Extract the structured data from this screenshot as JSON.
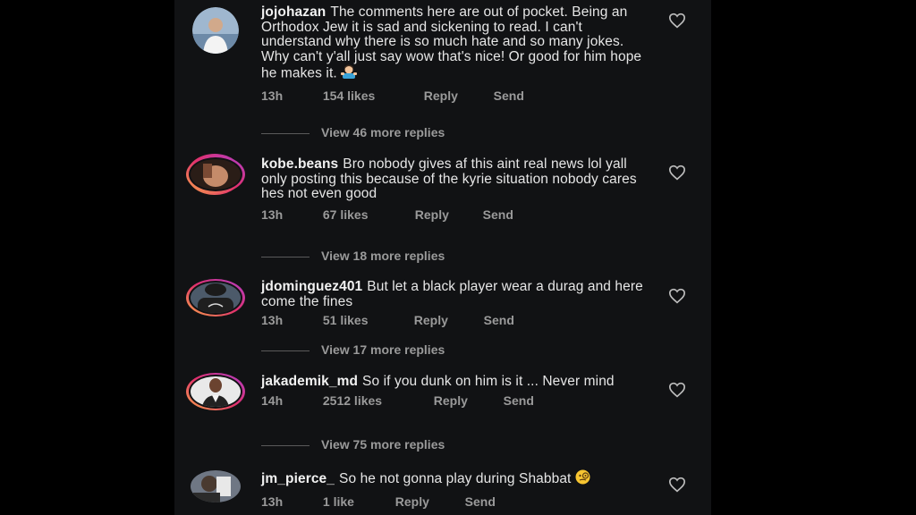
{
  "comments": [
    {
      "username": "jojohazan",
      "text": "The comments here are out of pocket. Being an Orthodox Jew it is sad and sickening to read. I can't understand why there is so much hate and so many jokes. Why can't y'all just say wow that's nice! Or good for him hope he makes it.",
      "time": "13h",
      "likes": "154 likes",
      "reply": "Reply",
      "send": "Send",
      "view_replies": "View 46 more replies",
      "emoji": "man-gesturing-icon"
    },
    {
      "username": "kobe.beans",
      "text": "Bro nobody gives af this aint real news lol yall only posting this because of the kyrie situation nobody cares hes not even good",
      "time": "13h",
      "likes": "67 likes",
      "reply": "Reply",
      "send": "Send",
      "view_replies": "View 18 more replies"
    },
    {
      "username": "jdominguez401",
      "text": "But let a black player wear a durag and here come the fines",
      "time": "13h",
      "likes": "51 likes",
      "reply": "Reply",
      "send": "Send",
      "view_replies": "View 17 more replies"
    },
    {
      "username": "jakademik_md",
      "text": "So if you dunk on him is it ... Never mind",
      "time": "14h",
      "likes": "2512 likes",
      "reply": "Reply",
      "send": "Send",
      "view_replies": "View 75 more replies"
    },
    {
      "username": "jm_pierce_",
      "text": "So he not gonna play during Shabbat",
      "time": "13h",
      "likes": "1 like",
      "reply": "Reply",
      "send": "Send",
      "emoji": "monocle-face-icon"
    }
  ],
  "colors": {
    "background": "#111214",
    "text": "#e6e6e6",
    "meta": "#9a9a9a",
    "story_ring": "#e1306c"
  }
}
